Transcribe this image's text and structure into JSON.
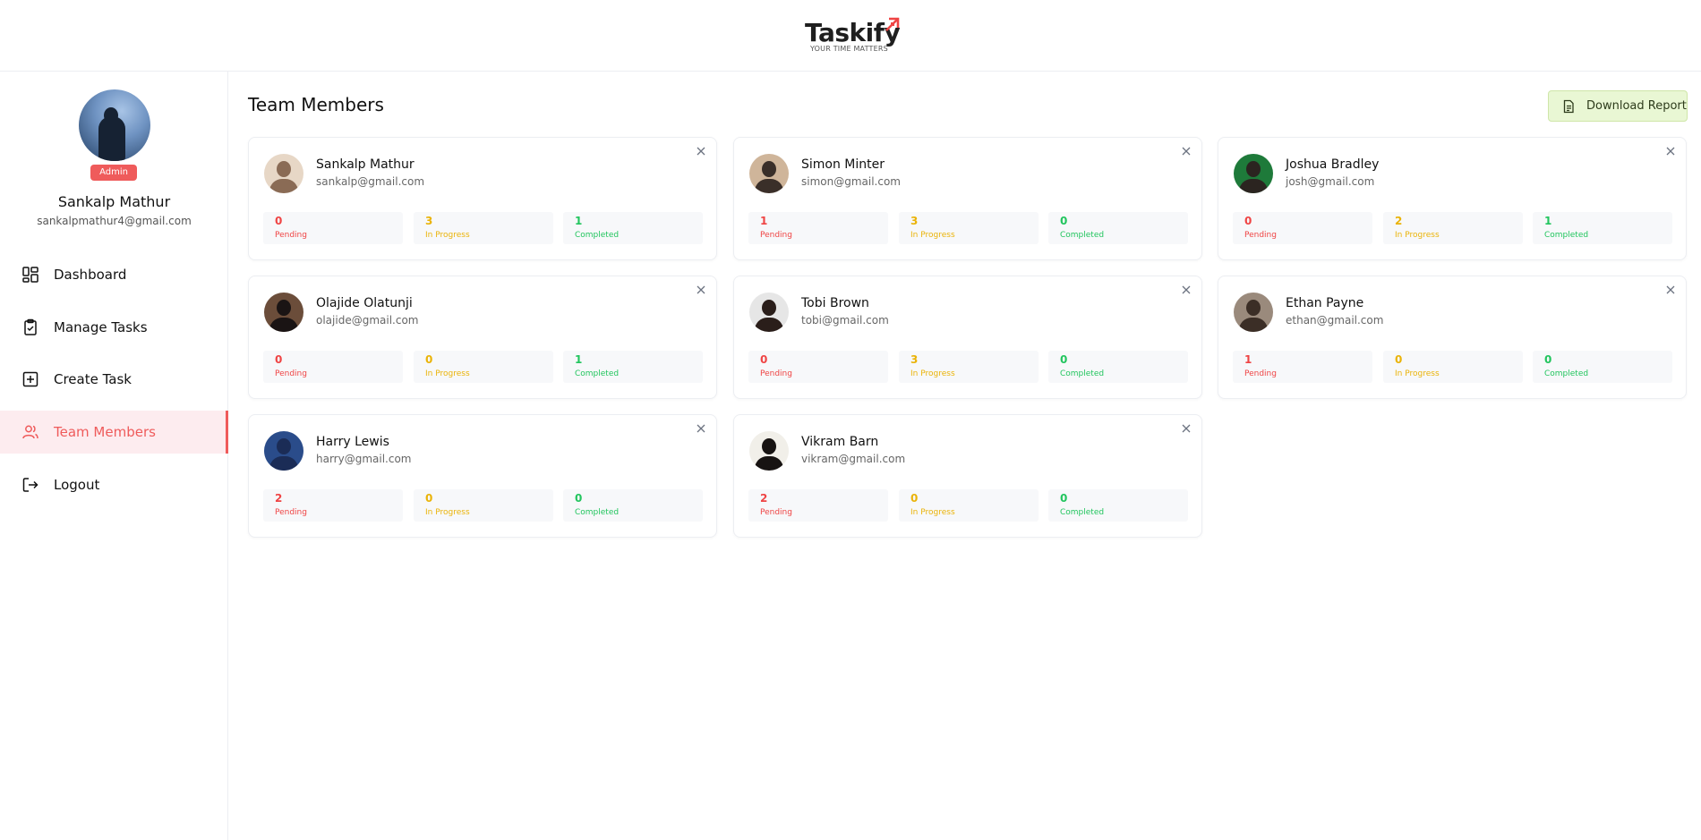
{
  "brand": {
    "name": "Taskify",
    "tagline": "YOUR TIME MATTERS",
    "accent": "#ef4444"
  },
  "profile": {
    "role": "Admin",
    "name": "Sankalp Mathur",
    "email": "sankalpmathur4@gmail.com"
  },
  "nav": [
    {
      "label": "Dashboard",
      "icon": "dashboard-icon"
    },
    {
      "label": "Manage Tasks",
      "icon": "clipboard-icon"
    },
    {
      "label": "Create Task",
      "icon": "plus-square-icon"
    },
    {
      "label": "Team Members",
      "icon": "users-icon",
      "active": true
    },
    {
      "label": "Logout",
      "icon": "logout-icon"
    }
  ],
  "page": {
    "title": "Team Members",
    "download_label": "Download Report"
  },
  "stat_labels": {
    "pending": "Pending",
    "in_progress": "In Progress",
    "completed": "Completed"
  },
  "colors": {
    "pending": "#ef4444",
    "in_progress": "#eab308",
    "completed": "#22c55e"
  },
  "members": [
    {
      "name": "Sankalp Mathur",
      "email": "sankalp@gmail.com",
      "pending": "0",
      "in_progress": "3",
      "completed": "1"
    },
    {
      "name": "Simon Minter",
      "email": "simon@gmail.com",
      "pending": "1",
      "in_progress": "3",
      "completed": "0"
    },
    {
      "name": "Joshua Bradley",
      "email": "josh@gmail.com",
      "pending": "0",
      "in_progress": "2",
      "completed": "1"
    },
    {
      "name": "Olajide Olatunji",
      "email": "olajide@gmail.com",
      "pending": "0",
      "in_progress": "0",
      "completed": "1"
    },
    {
      "name": "Tobi Brown",
      "email": "tobi@gmail.com",
      "pending": "0",
      "in_progress": "3",
      "completed": "0"
    },
    {
      "name": "Ethan Payne",
      "email": "ethan@gmail.com",
      "pending": "1",
      "in_progress": "0",
      "completed": "0"
    },
    {
      "name": "Harry Lewis",
      "email": "harry@gmail.com",
      "pending": "2",
      "in_progress": "0",
      "completed": "0"
    },
    {
      "name": "Vikram Barn",
      "email": "vikram@gmail.com",
      "pending": "2",
      "in_progress": "0",
      "completed": "0"
    }
  ]
}
